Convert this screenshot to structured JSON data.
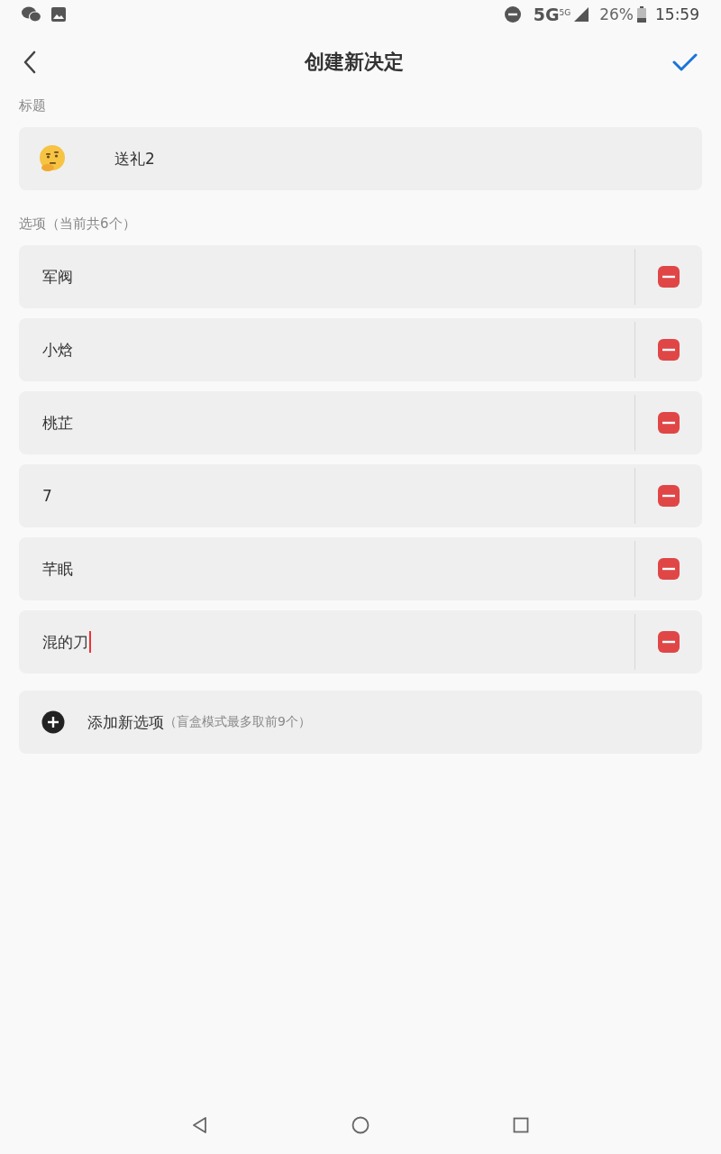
{
  "status_bar": {
    "network": "5G",
    "network_small": "5G",
    "battery": "26%",
    "time": "15:59"
  },
  "header": {
    "title": "创建新决定"
  },
  "title_section": {
    "label": "标题",
    "value": "送礼2"
  },
  "options_section": {
    "label": "选项（当前共6个）",
    "options": [
      {
        "value": "军阀",
        "focused": false
      },
      {
        "value": "小焓",
        "focused": false
      },
      {
        "value": "桃芷",
        "focused": false
      },
      {
        "value": "7",
        "focused": false
      },
      {
        "value": "芊眠",
        "focused": false
      },
      {
        "value": "混的刀",
        "focused": true
      }
    ]
  },
  "add_option": {
    "label": "添加新选项",
    "hint": "（盲盒模式最多取前9个）"
  }
}
